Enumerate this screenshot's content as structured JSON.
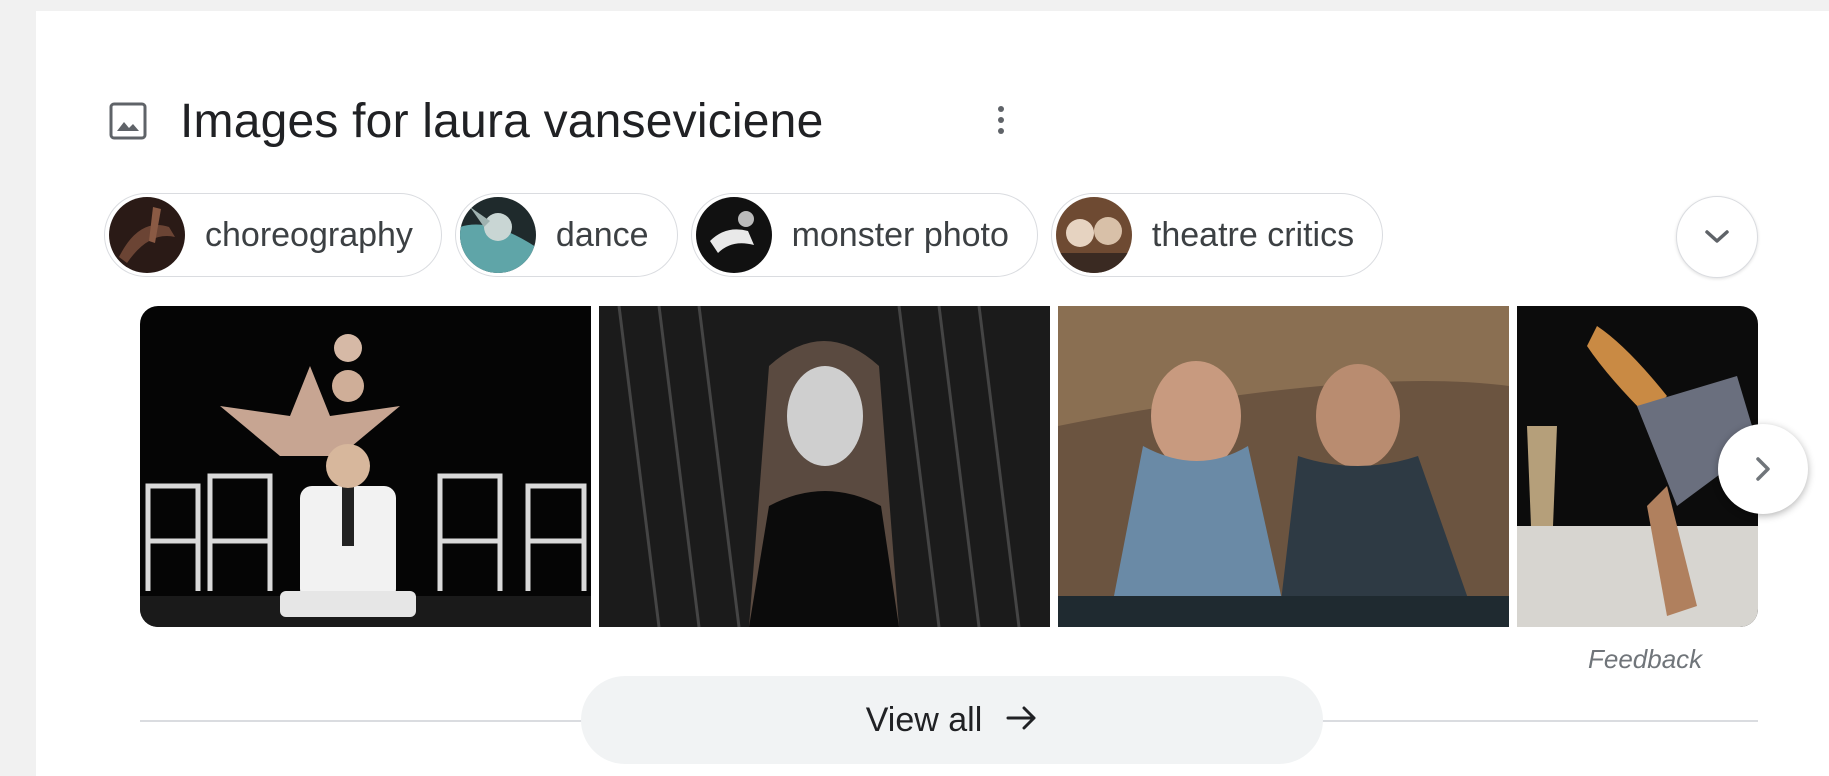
{
  "header": {
    "title": "Images for laura vanseviciene",
    "image_icon": "image-icon",
    "more_icon": "more-vert-icon"
  },
  "chips": [
    {
      "label": "choreography",
      "thumb": "chip-thumb-choreography"
    },
    {
      "label": "dance",
      "thumb": "chip-thumb-dance"
    },
    {
      "label": "monster photo",
      "thumb": "chip-thumb-monster-photo"
    },
    {
      "label": "theatre critics",
      "thumb": "chip-thumb-theatre-critics"
    }
  ],
  "expand_icon": "chevron-down-icon",
  "next_icon": "chevron-right-icon",
  "feedback": "Feedback",
  "view_all": {
    "label": "View all",
    "icon": "arrow-right-icon"
  },
  "colors": {
    "background": "#f1f1f1",
    "card": "#ffffff",
    "title_text": "#202124",
    "chip_border": "#dadce0",
    "view_all_bg": "#f1f3f4"
  }
}
